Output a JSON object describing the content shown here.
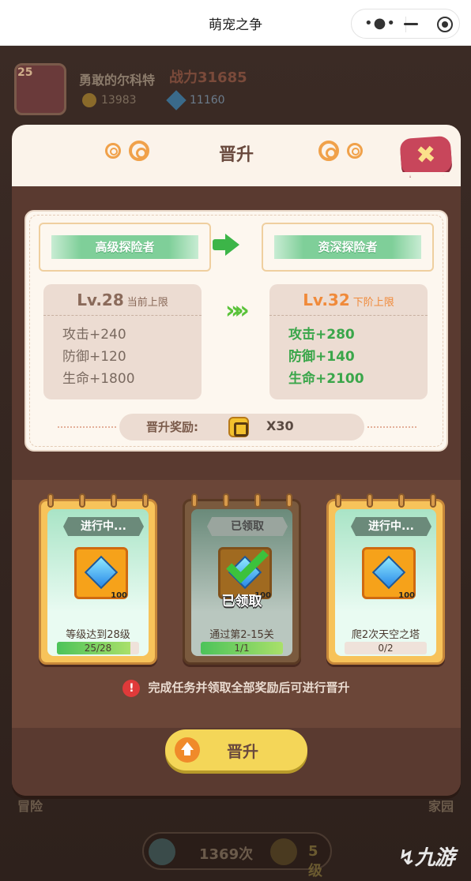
{
  "window": {
    "title": "萌宠之争",
    "menu_icon": "more-dots-icon",
    "minimize_icon": "minimize-icon",
    "record_icon": "record-icon"
  },
  "background": {
    "player_level": "25",
    "player_name": "勇敢的尔科特",
    "power_label": "战力",
    "power_value": "31685",
    "coins": "13983",
    "gems": "11160",
    "nav_left": "冒险",
    "nav_right": "家园",
    "counter": "1369次",
    "counter2": "5级"
  },
  "modal": {
    "title": "晋升",
    "close_icon": "close-icon",
    "current_rank": "高级探险者",
    "next_rank": "资深探险者",
    "current": {
      "level": "Lv.28",
      "cap_label": "当前上限",
      "stats": [
        "攻击+240",
        "防御+120",
        "生命+1800"
      ]
    },
    "next": {
      "level": "Lv.32",
      "cap_label": "下阶上限",
      "stats": [
        "攻击+280",
        "防御+140",
        "生命+2100"
      ]
    },
    "reward_label": "晋升奖励:",
    "reward_qty": "X30",
    "tasks": [
      {
        "status": "进行中...",
        "reward_count": "100",
        "desc": "等级达到28级",
        "progress": "25/28",
        "fraction": 0.89,
        "claimed": false
      },
      {
        "status": "已领取",
        "reward_count": "100",
        "desc": "通过第2-15关",
        "progress": "1/1",
        "fraction": 1.0,
        "claimed": true,
        "claimed_label": "已领取"
      },
      {
        "status": "进行中...",
        "reward_count": "100",
        "desc": "爬2次天空之塔",
        "progress": "0/2",
        "fraction": 0.0,
        "claimed": false
      }
    ],
    "hint": "完成任务并领取全部奖励后可进行晋升",
    "promote_label": "晋升"
  },
  "watermark": "九游",
  "colors": {
    "accent": "#f4d658",
    "green": "#3aa64a",
    "orange": "#f08a3a",
    "close": "#c8465b"
  }
}
